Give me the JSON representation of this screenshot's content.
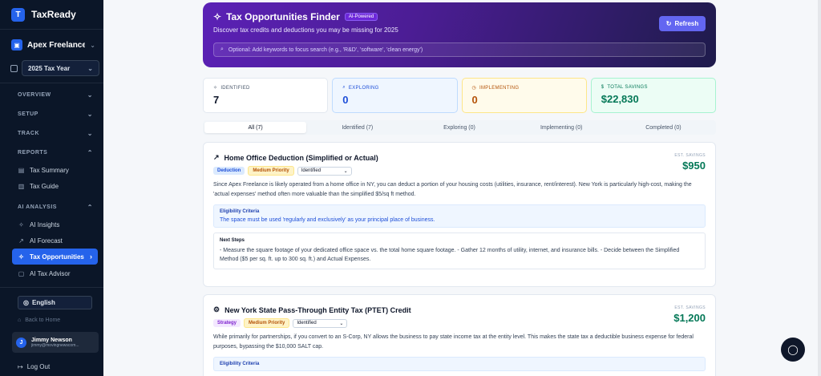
{
  "app": {
    "name": "TaxReady",
    "logo_letter": "T"
  },
  "sidebar": {
    "org_name": "Apex Freelance L...",
    "tax_year": "2025 Tax Year",
    "sections": {
      "overview": "OVERVIEW",
      "setup": "SETUP",
      "track": "TRACK",
      "reports": "REPORTS",
      "ai_analysis": "AI ANALYSIS"
    },
    "reports_items": [
      "Tax Summary",
      "Tax Guide"
    ],
    "ai_items": [
      "AI Insights",
      "AI Forecast",
      "Tax Opportunities",
      "AI Tax Advisor"
    ],
    "language": "English",
    "back_home": "Back to Home",
    "user": {
      "name": "Jimmy Newson",
      "email": "jimmy@movingnewscom...",
      "initial": "J"
    },
    "logout": "Log Out"
  },
  "hero": {
    "title": "Tax Opportunities Finder",
    "badge": "AI-Powered",
    "subtitle": "Discover tax credits and deductions you may be missing for 2025",
    "refresh_label": "Refresh",
    "search_placeholder": "Optional: Add keywords to focus search (e.g., 'R&D', 'software', 'clean energy')"
  },
  "stats": [
    {
      "label": "IDENTIFIED",
      "value": "7"
    },
    {
      "label": "EXPLORING",
      "value": "0"
    },
    {
      "label": "IMPLEMENTING",
      "value": "0"
    },
    {
      "label": "TOTAL SAVINGS",
      "value": "$22,830"
    }
  ],
  "tabs": [
    "All (7)",
    "Identified (7)",
    "Exploring (0)",
    "Implementing (0)",
    "Completed (0)"
  ],
  "cards": [
    {
      "title": "Home Office Deduction (Simplified or Actual)",
      "type_tag": "Deduction",
      "priority_tag": "Medium Priority",
      "status": "Identified",
      "savings_label": "EST. SAVINGS",
      "savings_value": "$950",
      "description": "Since Apex Freelance is likely operated from a home office in NY, you can deduct a portion of your housing costs (utilities, insurance, rent/interest). New York is particularly high-cost, making the 'actual expenses' method often more valuable than the simplified $5/sq ft method.",
      "eligibility_label": "Eligibility Criteria",
      "eligibility_text": "The space must be used 'regularly and exclusively' as your principal place of business.",
      "steps_label": "Next Steps",
      "steps_text": "- Measure the square footage of your dedicated office space vs. the total home square footage. - Gather 12 months of utility, internet, and insurance bills. - Decide between the Simplified Method ($5 per sq. ft. up to 300 sq. ft.) and Actual Expenses."
    },
    {
      "title": "New York State Pass-Through Entity Tax (PTET) Credit",
      "type_tag": "Strategy",
      "priority_tag": "Medium Priority",
      "status": "Identified",
      "savings_label": "EST. SAVINGS",
      "savings_value": "$1,200",
      "description": "While primarily for partnerships, if you convert to an S-Corp, NY allows the business to pay state income tax at the entity level. This makes the state tax a deductible business expense for federal purposes, bypassing the $10,000 SALT cap.",
      "eligibility_label": "Eligibility Criteria"
    }
  ]
}
